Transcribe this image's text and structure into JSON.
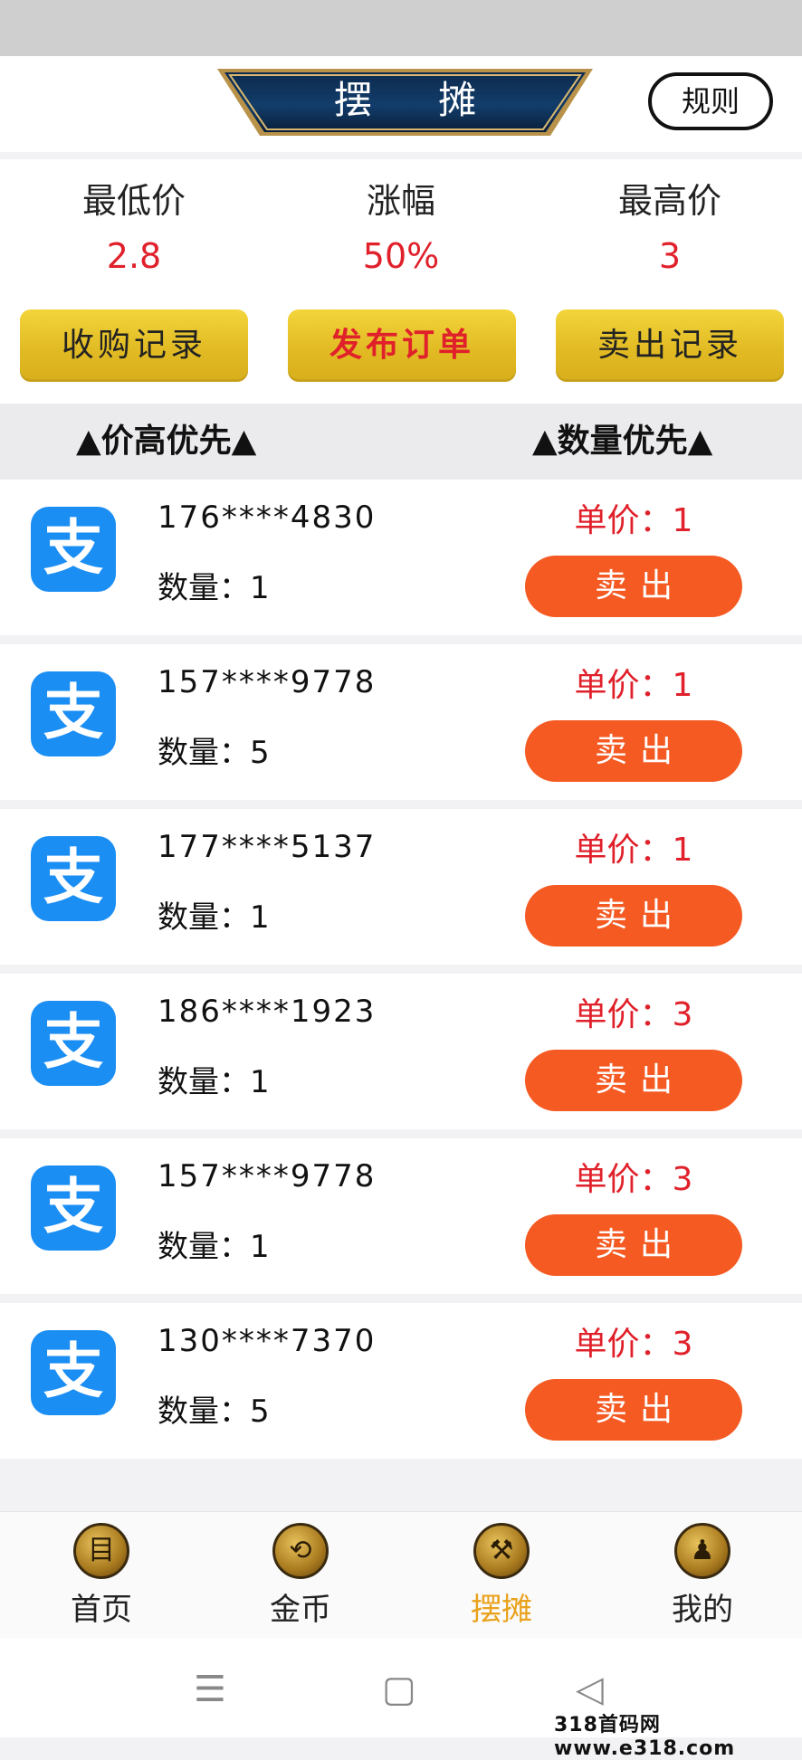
{
  "header": {
    "title": "摆 摊",
    "rules_label": "规则"
  },
  "stats": [
    {
      "label": "最低价",
      "value": "2.8"
    },
    {
      "label": "涨幅",
      "value": "50%"
    },
    {
      "label": "最高价",
      "value": "3"
    }
  ],
  "actions": {
    "buy_records": "收购记录",
    "publish_order": "发布订单",
    "sell_records": "卖出记录"
  },
  "sort": {
    "by_price": "▲价高优先▲",
    "by_quantity": "▲数量优先▲"
  },
  "orders": [
    {
      "phone": "176****4830",
      "qty_label": "数量：",
      "qty": "1",
      "price_label": "单价：",
      "price": "1",
      "sell_label": "卖出"
    },
    {
      "phone": "157****9778",
      "qty_label": "数量：",
      "qty": "5",
      "price_label": "单价：",
      "price": "1",
      "sell_label": "卖出"
    },
    {
      "phone": "177****5137",
      "qty_label": "数量：",
      "qty": "1",
      "price_label": "单价：",
      "price": "1",
      "sell_label": "卖出"
    },
    {
      "phone": "186****1923",
      "qty_label": "数量：",
      "qty": "1",
      "price_label": "单价：",
      "price": "3",
      "sell_label": "卖出"
    },
    {
      "phone": "157****9778",
      "qty_label": "数量：",
      "qty": "1",
      "price_label": "单价：",
      "price": "3",
      "sell_label": "卖出"
    },
    {
      "phone": "130****7370",
      "qty_label": "数量：",
      "qty": "5",
      "price_label": "单价：",
      "price": "3",
      "sell_label": "卖出"
    }
  ],
  "alipay_glyph": "支",
  "tabs": [
    {
      "label": "首页",
      "icon": "home-icon",
      "glyph": "目"
    },
    {
      "label": "金币",
      "icon": "coin-icon",
      "glyph": "⟲"
    },
    {
      "label": "摆摊",
      "icon": "stall-icon",
      "glyph": "⚒",
      "active": true
    },
    {
      "label": "我的",
      "icon": "profile-icon",
      "glyph": "♟"
    }
  ],
  "nav": {
    "menu": "☰",
    "home": "▢",
    "back": "◁"
  },
  "watermark": "318首码网 www.e318.com",
  "colors": {
    "accent_red": "#e0202a",
    "sell_orange": "#f45a22",
    "gold": "#e2bb24",
    "alipay_blue": "#1b8ef4",
    "active_tab": "#e9a21c"
  }
}
